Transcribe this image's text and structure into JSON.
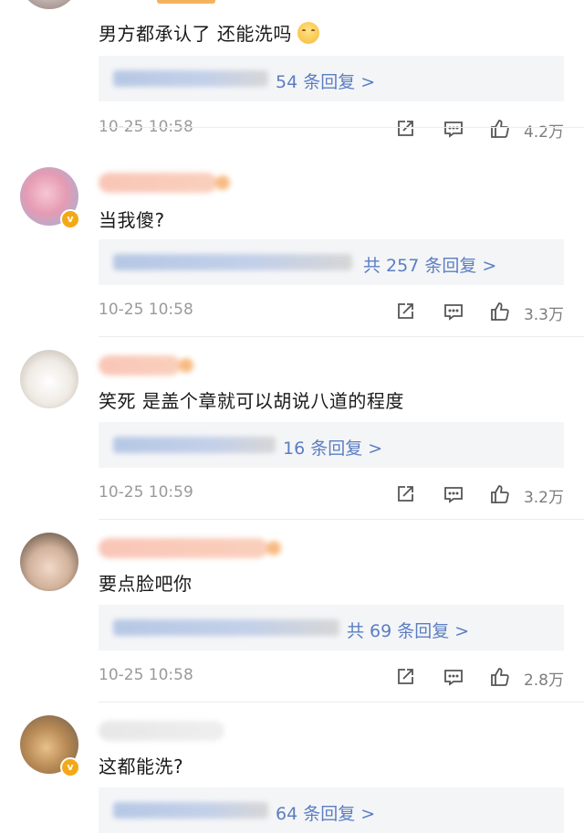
{
  "comments": [
    {
      "text": "男方都承认了 还能洗吗",
      "has_emoji": true,
      "reply_link": "54 条回复 >",
      "time": "10-25 10:58",
      "likes": "4.2万"
    },
    {
      "text": "当我傻?",
      "reply_link": "共 257 条回复 >",
      "time": "10-25 10:58",
      "likes": "3.3万"
    },
    {
      "text": "笑死 是盖个章就可以胡说八道的程度",
      "reply_link": "16 条回复 >",
      "time": "10-25 10:59",
      "likes": "3.2万"
    },
    {
      "text": "要点脸吧你",
      "reply_link": "共 69 条回复 >",
      "time": "10-25 10:58",
      "likes": "2.8万"
    },
    {
      "text": "这都能洗?",
      "reply_link": "64 条回复 >"
    }
  ],
  "colors": {
    "link": "#5b7ec2",
    "meta": "#9a9a9a",
    "verified_badge": "#f3a818",
    "reply_bg": "#f4f5f7"
  },
  "icons": [
    "share-icon",
    "comment-icon",
    "like-icon",
    "verified-badge-icon",
    "smile-emoji-icon"
  ]
}
